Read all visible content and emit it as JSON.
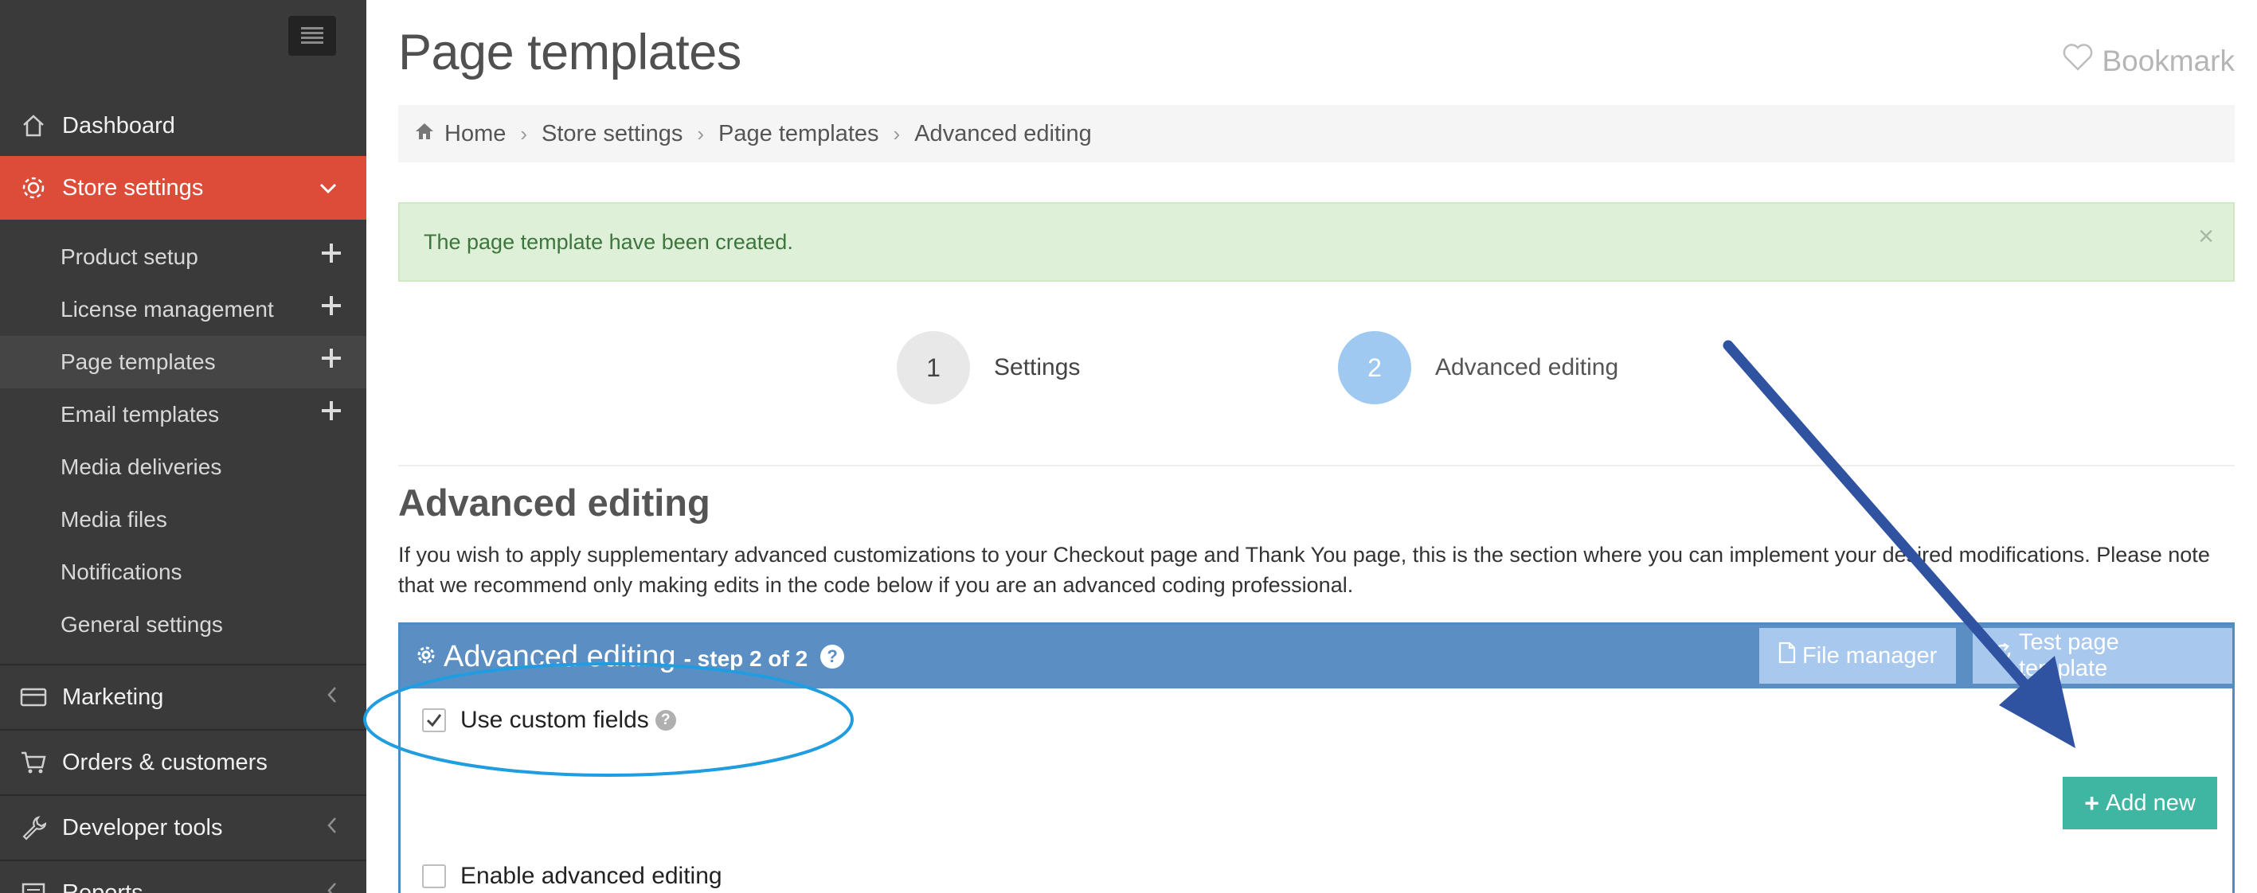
{
  "sidebar": {
    "items": [
      {
        "label": "Dashboard",
        "icon": "home-icon"
      },
      {
        "label": "Store settings",
        "icon": "gear-icon",
        "active": true
      },
      {
        "label": "Marketing",
        "icon": "card-icon"
      },
      {
        "label": "Orders & customers",
        "icon": "cart-icon"
      },
      {
        "label": "Developer tools",
        "icon": "wrench-icon"
      },
      {
        "label": "Reports",
        "icon": "list-icon"
      }
    ],
    "subitems": [
      {
        "label": "Product setup"
      },
      {
        "label": "License management"
      },
      {
        "label": "Page templates"
      },
      {
        "label": "Email templates"
      },
      {
        "label": "Media deliveries"
      },
      {
        "label": "Media files"
      },
      {
        "label": "Notifications"
      },
      {
        "label": "General settings"
      }
    ]
  },
  "header": {
    "title": "Page templates",
    "bookmark": "Bookmark"
  },
  "breadcrumb": [
    "Home",
    "Store settings",
    "Page templates",
    "Advanced editing"
  ],
  "alert": {
    "message": "The page template have been created.",
    "close": "×"
  },
  "steps": [
    {
      "number": "1",
      "label": "Settings"
    },
    {
      "number": "2",
      "label": "Advanced editing"
    }
  ],
  "section": {
    "title": "Advanced editing",
    "intro": "If you wish to apply supplementary advanced customizations to your Checkout page and Thank You page, this is the section where you can implement your desired modifications. Please note that we recommend only making edits in the code below if you are an advanced coding professional."
  },
  "panel": {
    "title": "Advanced editing",
    "subtitle": "- step 2 of 2",
    "file_manager": "File manager",
    "test_template": "Test page template",
    "use_custom_fields": "Use custom fields",
    "add_new": "Add new",
    "enable_advanced": "Enable advanced editing"
  },
  "colors": {
    "sidebar_bg": "#3a3a3a",
    "active_red": "#dd4b39",
    "panel_blue": "#5b8fc4",
    "add_button": "#3fb6a2",
    "annotation_arrow": "#2f52a1",
    "annotation_ellipse": "#1f9de0"
  }
}
